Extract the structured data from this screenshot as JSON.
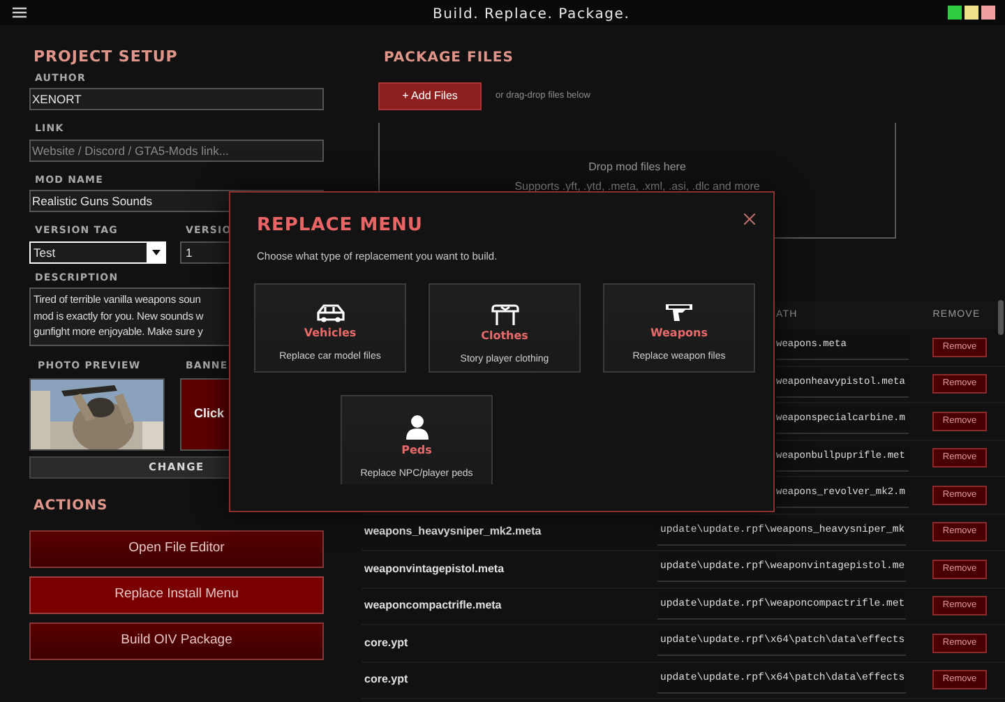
{
  "title_bar": {
    "title": "Build. Replace. Package."
  },
  "project_setup": {
    "heading": "PROJECT SETUP",
    "fields": [
      {
        "label": "AUTHOR",
        "value": "XENORT"
      },
      {
        "label": "LINK",
        "placeholder": "Website / Discord / GTA5-Mods link..."
      },
      {
        "label": "MOD NAME",
        "value": "Realistic Guns Sounds"
      }
    ],
    "version_tag": {
      "label": "VERSION TAG",
      "value": "Test"
    },
    "version": {
      "label": "VERSIO",
      "value": "1"
    },
    "description": {
      "label": "DESCRIPTION",
      "value": "Tired of terrible vanilla weapons soun\nmod is exactly for you. New sounds w\ngunfight more enjoyable. Make sure y"
    },
    "photo_preview": {
      "label": "PHOTO PREVIEW",
      "kind": "picture"
    },
    "banner": {
      "label": "BANNE",
      "text": "Click"
    },
    "change_button": "CHANGE"
  },
  "actions": {
    "heading": "ACTIONS",
    "buttons": [
      {
        "label": "Open File Editor",
        "selected": false
      },
      {
        "label": "Replace Install Menu",
        "selected": true
      },
      {
        "label": "Build OIV Package",
        "selected": false
      }
    ]
  },
  "package_files": {
    "heading": "PACKAGE FILES",
    "add_button": "+ Add Files",
    "hint": "or drag-drop files below",
    "drop_zone": {
      "title": "Drop mod files here",
      "subtitle": "Supports .yft, .ytd, .meta, .xml, .asi, .dlc and more"
    },
    "table": {
      "columns": [
        "ATH",
        "REMOVE"
      ],
      "rows": [
        {
          "path": "weapons.meta",
          "action": "Remove"
        },
        {
          "path": "weaponheavypistol.meta",
          "action": "Remove"
        },
        {
          "path": "weaponspecialcarbine.m",
          "action": "Remove"
        },
        {
          "path": "weaponbullpuprifle.met",
          "action": "Remove"
        },
        {
          "path": "weapons_revolver_mk2.m",
          "action": "Remove"
        },
        {
          "name": "weapons_heavysniper_mk2.meta",
          "path": "update\\update.rpf\\weapons_heavysniper_mk",
          "action": "Remove"
        },
        {
          "name": "weaponvintagepistol.meta",
          "path": "update\\update.rpf\\weaponvintagepistol.me",
          "action": "Remove"
        },
        {
          "name": "weaponcompactrifle.meta",
          "path": "update\\update.rpf\\weaponcompactrifle.met",
          "action": "Remove"
        },
        {
          "name": "core.ypt",
          "path": "update\\update.rpf\\x64\\patch\\data\\effects",
          "action": "Remove"
        },
        {
          "name": "core.ypt",
          "path": "update\\update.rpf\\x64\\patch\\data\\effects",
          "action": "Remove"
        }
      ]
    }
  },
  "replace_menu": {
    "title": "REPLACE MENU",
    "subtitle": "Choose what type of replacement you want to build.",
    "options": [
      {
        "kind": "vehicles",
        "title": "Vehicles",
        "description": "Replace car model files"
      },
      {
        "kind": "clothes",
        "title": "Clothes",
        "description": "Story player clothing"
      },
      {
        "kind": "weapons",
        "title": "Weapons",
        "description": "Replace weapon files"
      },
      {
        "kind": "peds",
        "title": "Peds",
        "description": "Replace NPC/player peds"
      }
    ]
  }
}
